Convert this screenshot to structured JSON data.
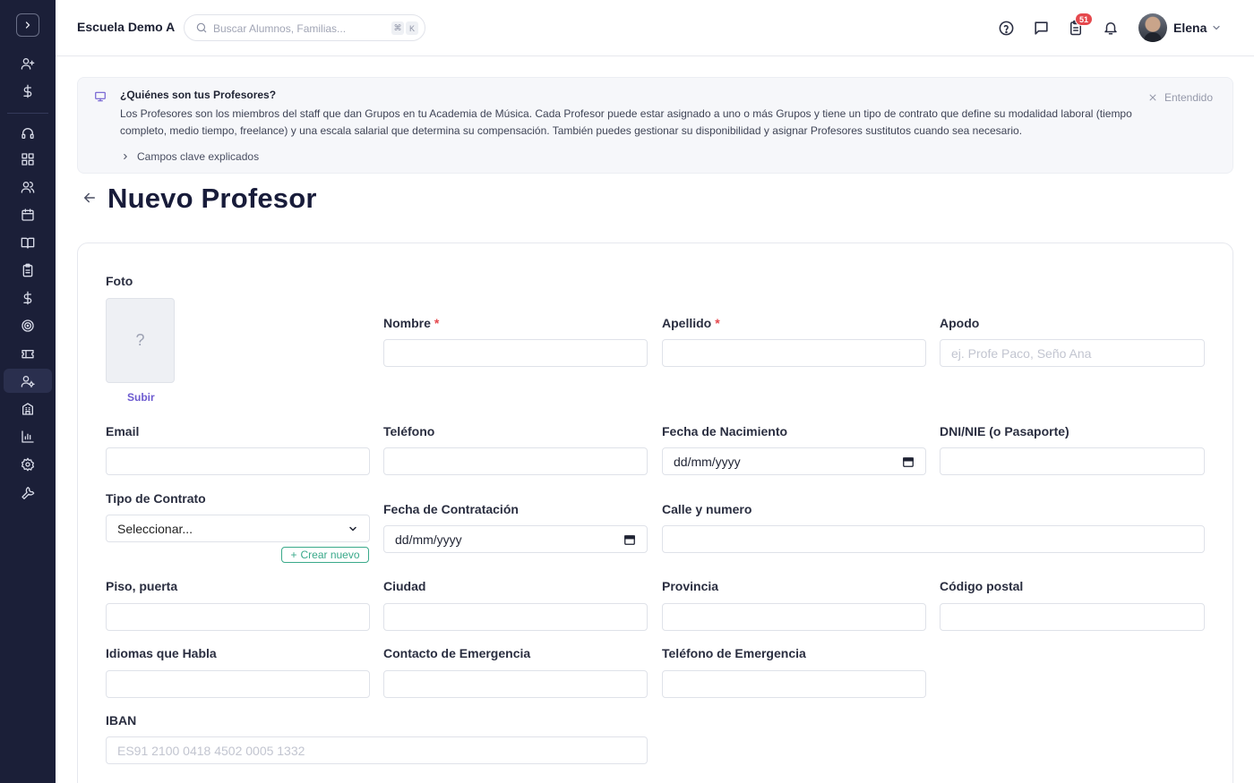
{
  "topbar": {
    "school_name": "Escuela Demo A",
    "search_placeholder": "Buscar Alumnos, Familias...",
    "shortcut_key1": "⌘",
    "shortcut_key2": "K",
    "notifications_badge": "51",
    "user_name": "Elena"
  },
  "sidebar": {
    "items": [
      "add-user",
      "dollar",
      "headset",
      "dashboard",
      "users",
      "calendar",
      "book",
      "clipboard",
      "dollar",
      "target",
      "ticket",
      "teacher",
      "building",
      "chart",
      "settings",
      "wrench"
    ]
  },
  "info": {
    "title": "¿Quiénes son tus Profesores?",
    "body": "Los Profesores son los miembros del staff que dan Grupos en tu Academia de Música. Cada Profesor puede estar asignado a uno o más Grupos y tiene un tipo de contrato que define su modalidad laboral (tiempo completo, medio tiempo, freelance) y una escala salarial que determina su compensación. También puedes gestionar su disponibilidad y asignar Profesores sustitutos cuando sea necesario.",
    "more_label": "Campos clave explicados",
    "dismiss_label": "Entendido"
  },
  "page": {
    "title": "Nuevo Profesor"
  },
  "form": {
    "photo_label": "Foto",
    "photo_placeholder": "?",
    "upload_label": "Subir",
    "nombre_label": "Nombre",
    "apellido_label": "Apellido",
    "apodo_label": "Apodo",
    "apodo_placeholder": "ej. Profe Paco, Seño Ana",
    "email_label": "Email",
    "telefono_label": "Teléfono",
    "fecha_nac_label": "Fecha de Nacimiento",
    "fecha_nac_value": "dd/mm/yyyy",
    "dni_label": "DNI/NIE (o Pasaporte)",
    "contrato_label": "Tipo de Contrato",
    "contrato_value": "Seleccionar...",
    "crear_nuevo_label": "Crear nuevo",
    "fecha_contr_label": "Fecha de Contratación",
    "fecha_contr_value": "dd/mm/yyyy",
    "calle_label": "Calle y numero",
    "piso_label": "Piso, puerta",
    "ciudad_label": "Ciudad",
    "provincia_label": "Provincia",
    "cp_label": "Código postal",
    "idiomas_label": "Idiomas que Habla",
    "contacto_em_label": "Contacto de Emergencia",
    "telefono_em_label": "Teléfono de Emergencia",
    "iban_label": "IBAN",
    "iban_placeholder": "ES91 2100 0418 4502 0005 1332",
    "required_mark": "*"
  },
  "colors": {
    "sidebar_bg": "#1b1f38",
    "accent": "#6d5bd0",
    "required": "#e5484d",
    "create_new": "#3aa98a",
    "badge": "#e5484d"
  }
}
